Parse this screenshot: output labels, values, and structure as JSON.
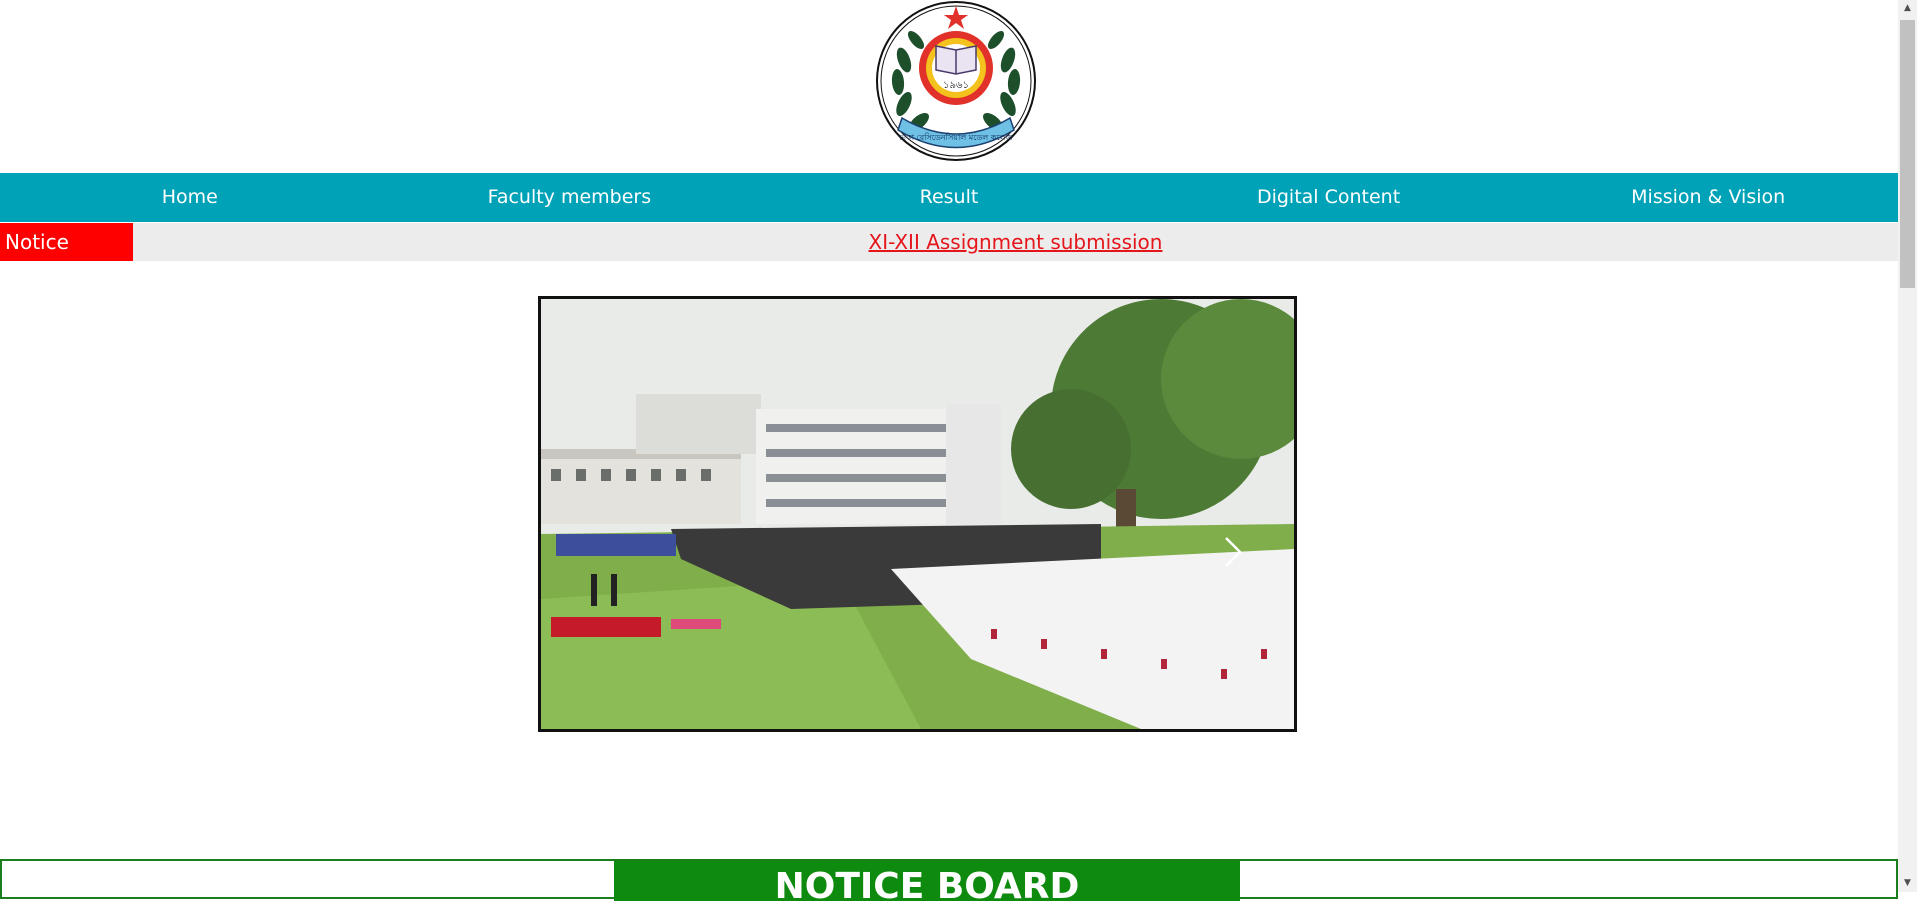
{
  "header": {
    "logo_year": "১৯৬১",
    "logo_banner_text": "ঢাকা রেসিডেনসিয়াল মডেল কলেজ"
  },
  "nav": {
    "items": [
      "Home",
      "Faculty members",
      "Result",
      "Digital Content",
      "Mission & Vision"
    ]
  },
  "notice": {
    "label": "Notice",
    "link_text": "XI-XII Assignment submission"
  },
  "slider": {
    "next_icon": "chevron-right-icon"
  },
  "notice_board": {
    "title": "NOTICE BOARD"
  },
  "colors": {
    "nav_bg": "#00a2b8",
    "notice_label_bg": "#ff0000",
    "notice_link": "#e5161b",
    "notice_board_bg": "#0e8a0e"
  }
}
